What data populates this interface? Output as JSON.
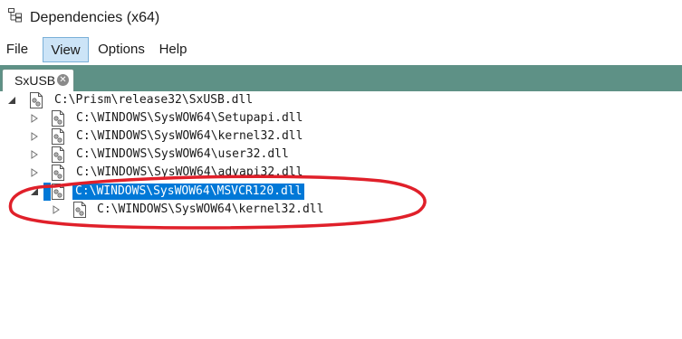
{
  "window": {
    "title": "Dependencies (x64)",
    "icon": "dependency-tree-icon"
  },
  "menubar": {
    "items": [
      {
        "label": "File"
      },
      {
        "label": "View",
        "active": true
      },
      {
        "label": "Options"
      },
      {
        "label": "Help"
      }
    ]
  },
  "tabs": [
    {
      "label": "SxUSB",
      "close_icon": "close-circle-icon"
    }
  ],
  "tree": {
    "rows": [
      {
        "label": "C:\\Prism\\release32\\SxUSB.dll",
        "expanded": true,
        "depth": 0
      },
      {
        "label": "C:\\WINDOWS\\SysWOW64\\Setupapi.dll",
        "expanded": false,
        "depth": 1
      },
      {
        "label": "C:\\WINDOWS\\SysWOW64\\kernel32.dll",
        "expanded": false,
        "depth": 1
      },
      {
        "label": "C:\\WINDOWS\\SysWOW64\\user32.dll",
        "expanded": false,
        "depth": 1
      },
      {
        "label": "C:\\WINDOWS\\SysWOW64\\advapi32.dll",
        "expanded": false,
        "depth": 1
      },
      {
        "label": "C:\\WINDOWS\\SysWOW64\\MSVCR120.dll",
        "expanded": true,
        "selected": true,
        "depth": 1
      },
      {
        "label": "C:\\WINDOWS\\SysWOW64\\kernel32.dll",
        "expanded": false,
        "depth": 2
      }
    ]
  },
  "colors": {
    "tabstrip": "#5e9186",
    "selection": "#0078d7",
    "annotation": "#e0202a",
    "menu_active": "#cce4f7"
  }
}
